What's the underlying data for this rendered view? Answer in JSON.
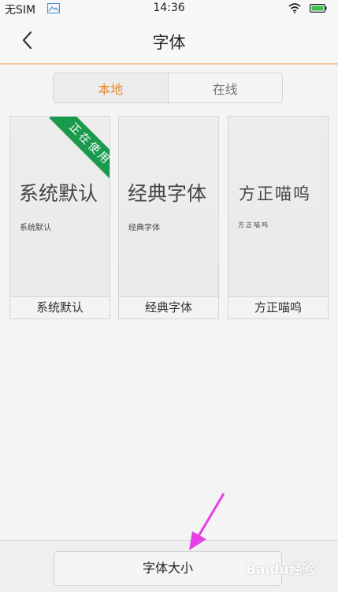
{
  "status_bar": {
    "carrier": "无SIM",
    "time": "14:36"
  },
  "header": {
    "title": "字体",
    "back_icon": "chevron-left-icon"
  },
  "tabs": [
    {
      "label": "本地",
      "active": true
    },
    {
      "label": "在线",
      "active": false
    }
  ],
  "fonts": [
    {
      "preview_large": "系统默认",
      "preview_small": "系统默认",
      "name": "系统默认",
      "badge": "正在使用"
    },
    {
      "preview_large": "经典字体",
      "preview_small": "经典字体",
      "name": "经典字体"
    },
    {
      "preview_large": "方正喵呜",
      "preview_small": "方正喵呜",
      "name": "方正喵呜"
    }
  ],
  "bottom": {
    "font_size_label": "字体大小"
  },
  "watermark": "Baidu经验",
  "colors": {
    "accent": "#e8892c",
    "badge": "#1a9a4c",
    "arrow": "#e83ee6"
  }
}
